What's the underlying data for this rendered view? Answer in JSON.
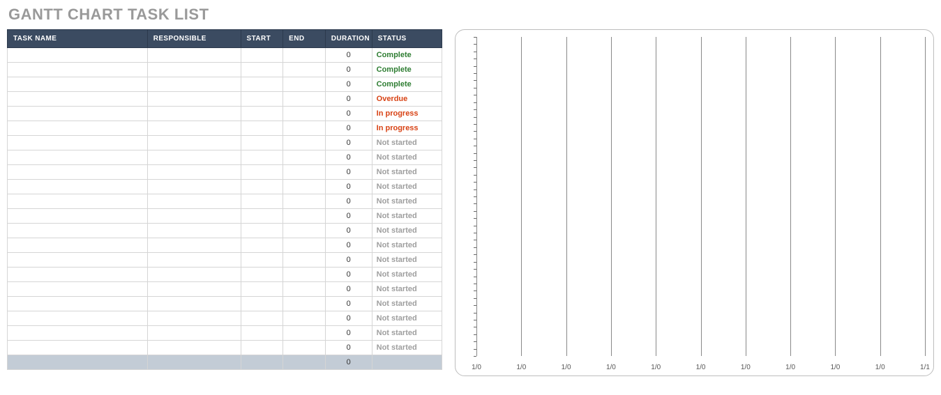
{
  "title": "GANTT CHART TASK LIST",
  "table": {
    "headers": {
      "task": "TASK NAME",
      "responsible": "RESPONSIBLE",
      "start": "START",
      "end": "END",
      "duration": "DURATION",
      "status": "STATUS"
    },
    "rows": [
      {
        "task": "",
        "responsible": "",
        "start": "",
        "end": "",
        "duration": "0",
        "status": "Complete"
      },
      {
        "task": "",
        "responsible": "",
        "start": "",
        "end": "",
        "duration": "0",
        "status": "Complete"
      },
      {
        "task": "",
        "responsible": "",
        "start": "",
        "end": "",
        "duration": "0",
        "status": "Complete"
      },
      {
        "task": "",
        "responsible": "",
        "start": "",
        "end": "",
        "duration": "0",
        "status": "Overdue"
      },
      {
        "task": "",
        "responsible": "",
        "start": "",
        "end": "",
        "duration": "0",
        "status": "In progress"
      },
      {
        "task": "",
        "responsible": "",
        "start": "",
        "end": "",
        "duration": "0",
        "status": "In progress"
      },
      {
        "task": "",
        "responsible": "",
        "start": "",
        "end": "",
        "duration": "0",
        "status": "Not started"
      },
      {
        "task": "",
        "responsible": "",
        "start": "",
        "end": "",
        "duration": "0",
        "status": "Not started"
      },
      {
        "task": "",
        "responsible": "",
        "start": "",
        "end": "",
        "duration": "0",
        "status": "Not started"
      },
      {
        "task": "",
        "responsible": "",
        "start": "",
        "end": "",
        "duration": "0",
        "status": "Not started"
      },
      {
        "task": "",
        "responsible": "",
        "start": "",
        "end": "",
        "duration": "0",
        "status": "Not started"
      },
      {
        "task": "",
        "responsible": "",
        "start": "",
        "end": "",
        "duration": "0",
        "status": "Not started"
      },
      {
        "task": "",
        "responsible": "",
        "start": "",
        "end": "",
        "duration": "0",
        "status": "Not started"
      },
      {
        "task": "",
        "responsible": "",
        "start": "",
        "end": "",
        "duration": "0",
        "status": "Not started"
      },
      {
        "task": "",
        "responsible": "",
        "start": "",
        "end": "",
        "duration": "0",
        "status": "Not started"
      },
      {
        "task": "",
        "responsible": "",
        "start": "",
        "end": "",
        "duration": "0",
        "status": "Not started"
      },
      {
        "task": "",
        "responsible": "",
        "start": "",
        "end": "",
        "duration": "0",
        "status": "Not started"
      },
      {
        "task": "",
        "responsible": "",
        "start": "",
        "end": "",
        "duration": "0",
        "status": "Not started"
      },
      {
        "task": "",
        "responsible": "",
        "start": "",
        "end": "",
        "duration": "0",
        "status": "Not started"
      },
      {
        "task": "",
        "responsible": "",
        "start": "",
        "end": "",
        "duration": "0",
        "status": "Not started"
      },
      {
        "task": "",
        "responsible": "",
        "start": "",
        "end": "",
        "duration": "0",
        "status": "Not started"
      }
    ],
    "totals": {
      "task": "",
      "responsible": "",
      "start": "",
      "end": "",
      "duration": "0",
      "status": ""
    }
  },
  "chart_data": {
    "type": "bar",
    "title": "",
    "xlabel": "",
    "ylabel": "",
    "x_ticks": [
      "1/0",
      "1/0",
      "1/0",
      "1/0",
      "1/0",
      "1/0",
      "1/0",
      "1/0",
      "1/0",
      "1/0",
      "1/1"
    ],
    "y_tick_count": 44,
    "series": []
  }
}
